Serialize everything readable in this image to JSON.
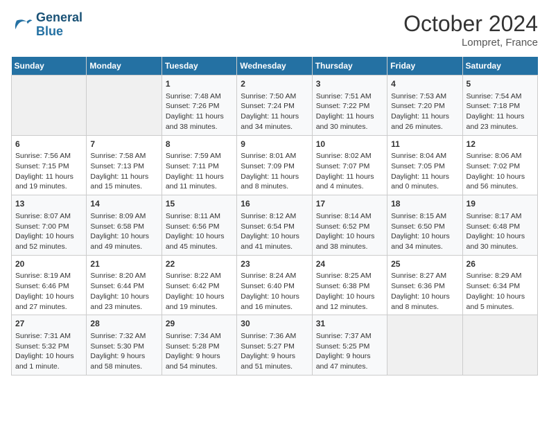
{
  "header": {
    "logo_line1": "General",
    "logo_line2": "Blue",
    "month": "October 2024",
    "location": "Lompret, France"
  },
  "weekdays": [
    "Sunday",
    "Monday",
    "Tuesday",
    "Wednesday",
    "Thursday",
    "Friday",
    "Saturday"
  ],
  "weeks": [
    [
      {
        "day": "",
        "sunrise": "",
        "sunset": "",
        "daylight": ""
      },
      {
        "day": "",
        "sunrise": "",
        "sunset": "",
        "daylight": ""
      },
      {
        "day": "1",
        "sunrise": "Sunrise: 7:48 AM",
        "sunset": "Sunset: 7:26 PM",
        "daylight": "Daylight: 11 hours and 38 minutes."
      },
      {
        "day": "2",
        "sunrise": "Sunrise: 7:50 AM",
        "sunset": "Sunset: 7:24 PM",
        "daylight": "Daylight: 11 hours and 34 minutes."
      },
      {
        "day": "3",
        "sunrise": "Sunrise: 7:51 AM",
        "sunset": "Sunset: 7:22 PM",
        "daylight": "Daylight: 11 hours and 30 minutes."
      },
      {
        "day": "4",
        "sunrise": "Sunrise: 7:53 AM",
        "sunset": "Sunset: 7:20 PM",
        "daylight": "Daylight: 11 hours and 26 minutes."
      },
      {
        "day": "5",
        "sunrise": "Sunrise: 7:54 AM",
        "sunset": "Sunset: 7:18 PM",
        "daylight": "Daylight: 11 hours and 23 minutes."
      }
    ],
    [
      {
        "day": "6",
        "sunrise": "Sunrise: 7:56 AM",
        "sunset": "Sunset: 7:15 PM",
        "daylight": "Daylight: 11 hours and 19 minutes."
      },
      {
        "day": "7",
        "sunrise": "Sunrise: 7:58 AM",
        "sunset": "Sunset: 7:13 PM",
        "daylight": "Daylight: 11 hours and 15 minutes."
      },
      {
        "day": "8",
        "sunrise": "Sunrise: 7:59 AM",
        "sunset": "Sunset: 7:11 PM",
        "daylight": "Daylight: 11 hours and 11 minutes."
      },
      {
        "day": "9",
        "sunrise": "Sunrise: 8:01 AM",
        "sunset": "Sunset: 7:09 PM",
        "daylight": "Daylight: 11 hours and 8 minutes."
      },
      {
        "day": "10",
        "sunrise": "Sunrise: 8:02 AM",
        "sunset": "Sunset: 7:07 PM",
        "daylight": "Daylight: 11 hours and 4 minutes."
      },
      {
        "day": "11",
        "sunrise": "Sunrise: 8:04 AM",
        "sunset": "Sunset: 7:05 PM",
        "daylight": "Daylight: 11 hours and 0 minutes."
      },
      {
        "day": "12",
        "sunrise": "Sunrise: 8:06 AM",
        "sunset": "Sunset: 7:02 PM",
        "daylight": "Daylight: 10 hours and 56 minutes."
      }
    ],
    [
      {
        "day": "13",
        "sunrise": "Sunrise: 8:07 AM",
        "sunset": "Sunset: 7:00 PM",
        "daylight": "Daylight: 10 hours and 52 minutes."
      },
      {
        "day": "14",
        "sunrise": "Sunrise: 8:09 AM",
        "sunset": "Sunset: 6:58 PM",
        "daylight": "Daylight: 10 hours and 49 minutes."
      },
      {
        "day": "15",
        "sunrise": "Sunrise: 8:11 AM",
        "sunset": "Sunset: 6:56 PM",
        "daylight": "Daylight: 10 hours and 45 minutes."
      },
      {
        "day": "16",
        "sunrise": "Sunrise: 8:12 AM",
        "sunset": "Sunset: 6:54 PM",
        "daylight": "Daylight: 10 hours and 41 minutes."
      },
      {
        "day": "17",
        "sunrise": "Sunrise: 8:14 AM",
        "sunset": "Sunset: 6:52 PM",
        "daylight": "Daylight: 10 hours and 38 minutes."
      },
      {
        "day": "18",
        "sunrise": "Sunrise: 8:15 AM",
        "sunset": "Sunset: 6:50 PM",
        "daylight": "Daylight: 10 hours and 34 minutes."
      },
      {
        "day": "19",
        "sunrise": "Sunrise: 8:17 AM",
        "sunset": "Sunset: 6:48 PM",
        "daylight": "Daylight: 10 hours and 30 minutes."
      }
    ],
    [
      {
        "day": "20",
        "sunrise": "Sunrise: 8:19 AM",
        "sunset": "Sunset: 6:46 PM",
        "daylight": "Daylight: 10 hours and 27 minutes."
      },
      {
        "day": "21",
        "sunrise": "Sunrise: 8:20 AM",
        "sunset": "Sunset: 6:44 PM",
        "daylight": "Daylight: 10 hours and 23 minutes."
      },
      {
        "day": "22",
        "sunrise": "Sunrise: 8:22 AM",
        "sunset": "Sunset: 6:42 PM",
        "daylight": "Daylight: 10 hours and 19 minutes."
      },
      {
        "day": "23",
        "sunrise": "Sunrise: 8:24 AM",
        "sunset": "Sunset: 6:40 PM",
        "daylight": "Daylight: 10 hours and 16 minutes."
      },
      {
        "day": "24",
        "sunrise": "Sunrise: 8:25 AM",
        "sunset": "Sunset: 6:38 PM",
        "daylight": "Daylight: 10 hours and 12 minutes."
      },
      {
        "day": "25",
        "sunrise": "Sunrise: 8:27 AM",
        "sunset": "Sunset: 6:36 PM",
        "daylight": "Daylight: 10 hours and 8 minutes."
      },
      {
        "day": "26",
        "sunrise": "Sunrise: 8:29 AM",
        "sunset": "Sunset: 6:34 PM",
        "daylight": "Daylight: 10 hours and 5 minutes."
      }
    ],
    [
      {
        "day": "27",
        "sunrise": "Sunrise: 7:31 AM",
        "sunset": "Sunset: 5:32 PM",
        "daylight": "Daylight: 10 hours and 1 minute."
      },
      {
        "day": "28",
        "sunrise": "Sunrise: 7:32 AM",
        "sunset": "Sunset: 5:30 PM",
        "daylight": "Daylight: 9 hours and 58 minutes."
      },
      {
        "day": "29",
        "sunrise": "Sunrise: 7:34 AM",
        "sunset": "Sunset: 5:28 PM",
        "daylight": "Daylight: 9 hours and 54 minutes."
      },
      {
        "day": "30",
        "sunrise": "Sunrise: 7:36 AM",
        "sunset": "Sunset: 5:27 PM",
        "daylight": "Daylight: 9 hours and 51 minutes."
      },
      {
        "day": "31",
        "sunrise": "Sunrise: 7:37 AM",
        "sunset": "Sunset: 5:25 PM",
        "daylight": "Daylight: 9 hours and 47 minutes."
      },
      {
        "day": "",
        "sunrise": "",
        "sunset": "",
        "daylight": ""
      },
      {
        "day": "",
        "sunrise": "",
        "sunset": "",
        "daylight": ""
      }
    ]
  ]
}
